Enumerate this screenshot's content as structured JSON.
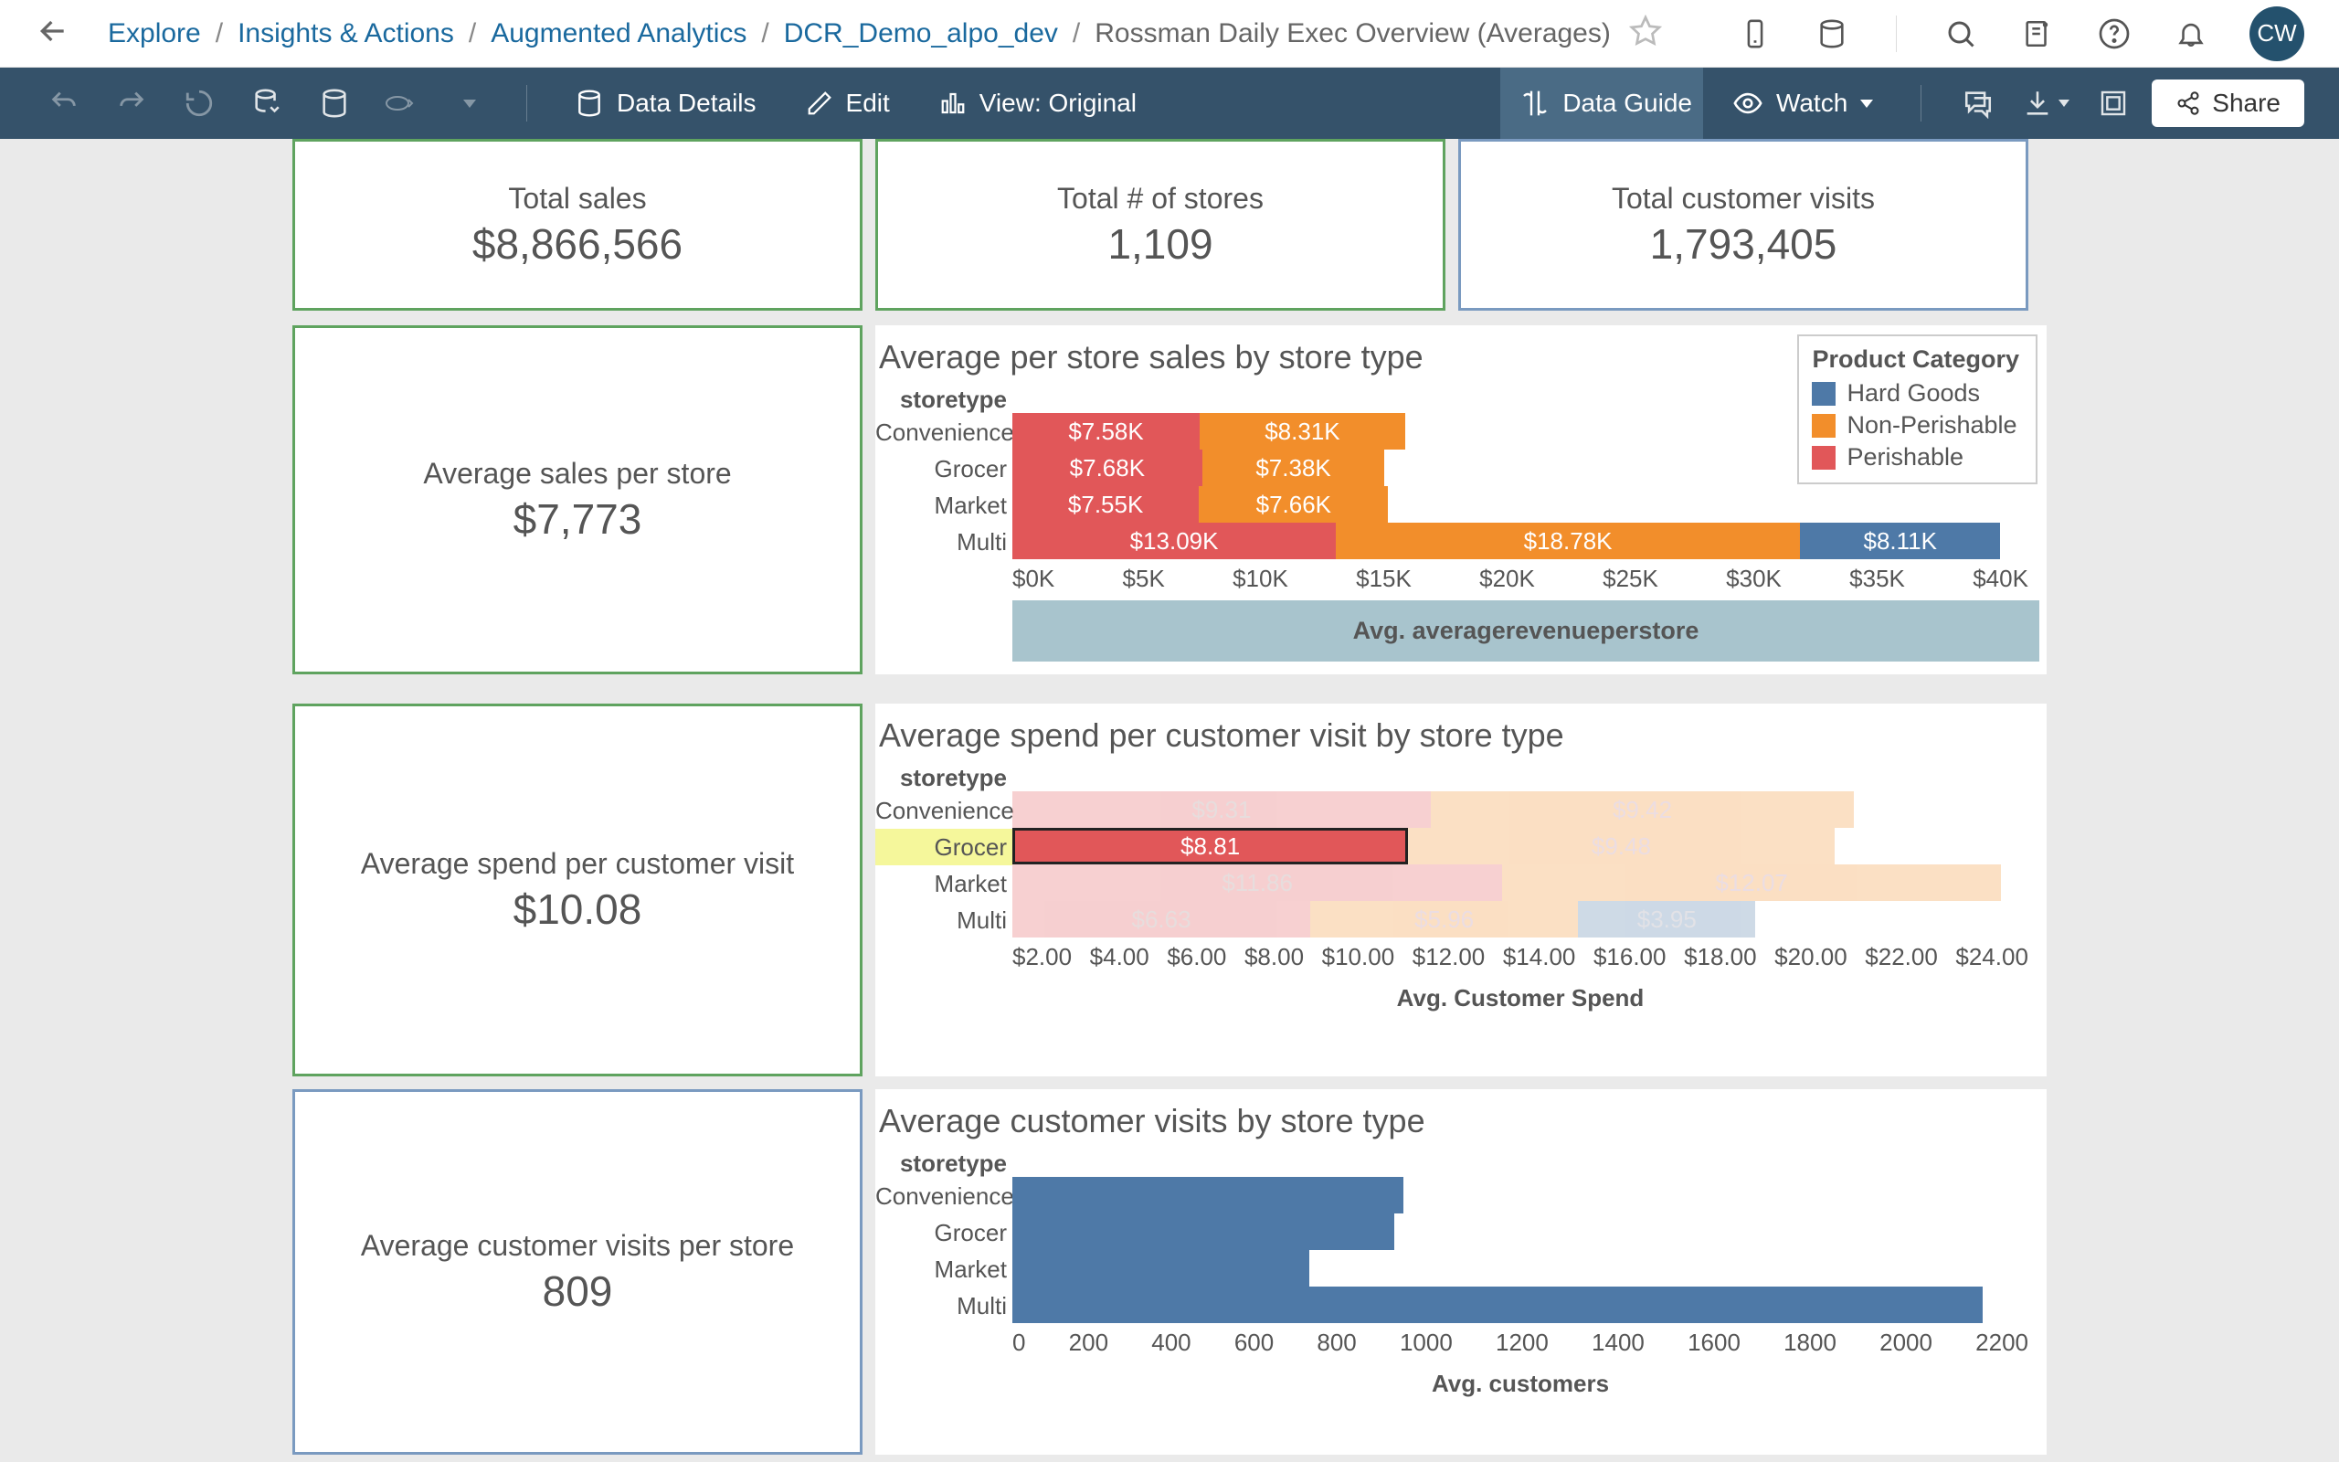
{
  "breadcrumb": {
    "items": [
      "Explore",
      "Insights & Actions",
      "Augmented Analytics",
      "DCR_Demo_alpo_dev"
    ],
    "current": "Rossman Daily Exec Overview (Averages)"
  },
  "avatar": "CW",
  "toolbar": {
    "data_details": "Data Details",
    "edit": "Edit",
    "view": "View: Original",
    "data_guide": "Data Guide",
    "watch": "Watch",
    "share": "Share"
  },
  "kpis": {
    "total_sales": {
      "label": "Total sales",
      "value": "$8,866,566"
    },
    "total_stores": {
      "label": "Total # of stores",
      "value": "1,109"
    },
    "total_visits": {
      "label": "Total customer visits",
      "value": "1,793,405"
    },
    "avg_sales": {
      "label": "Average sales per store",
      "value": "$7,773"
    },
    "avg_spend": {
      "label": "Average spend per customer visit",
      "value": "$10.08"
    },
    "avg_visits": {
      "label": "Average customer visits per store",
      "value": "809"
    }
  },
  "legend": {
    "title": "Product Category",
    "items": [
      {
        "name": "Hard Goods",
        "color": "#4e79a7"
      },
      {
        "name": "Non-Perishable",
        "color": "#f28e2b"
      },
      {
        "name": "Perishable",
        "color": "#e15759"
      }
    ]
  },
  "chart_data": [
    {
      "id": "avg_sales_by_type",
      "title": "Average per store sales by store type",
      "type": "bar",
      "stacked": true,
      "orientation": "h",
      "ylabel": "storetype",
      "xlabel": "Avg. averagerevenueperstore",
      "xlim": [
        0,
        40
      ],
      "xticks": [
        "$0K",
        "$5K",
        "$10K",
        "$15K",
        "$20K",
        "$25K",
        "$30K",
        "$35K",
        "$40K"
      ],
      "categories": [
        "Convenience",
        "Grocer",
        "Market",
        "Multi"
      ],
      "series": [
        {
          "name": "Perishable",
          "color": "#e15759",
          "values": [
            7.58,
            7.68,
            7.55,
            13.09
          ],
          "labels": [
            "$7.58K",
            "$7.68K",
            "$7.55K",
            "$13.09K"
          ]
        },
        {
          "name": "Non-Perishable",
          "color": "#f28e2b",
          "values": [
            8.31,
            7.38,
            7.66,
            18.78
          ],
          "labels": [
            "$8.31K",
            "$7.38K",
            "$7.66K",
            "$18.78K"
          ]
        },
        {
          "name": "Hard Goods",
          "color": "#4e79a7",
          "values": [
            0,
            0,
            0,
            8.11
          ],
          "labels": [
            "",
            "",
            "",
            "$8.11K"
          ]
        }
      ]
    },
    {
      "id": "avg_spend_by_type",
      "title": "Average spend per customer visit by store type",
      "type": "bar",
      "stacked": true,
      "orientation": "h",
      "ylabel": "storetype",
      "xlabel": "Avg. Customer Spend",
      "xlim": [
        2,
        24
      ],
      "xticks": [
        "$2.00",
        "$4.00",
        "$6.00",
        "$8.00",
        "$10.00",
        "$12.00",
        "$14.00",
        "$16.00",
        "$18.00",
        "$20.00",
        "$22.00",
        "$24.00"
      ],
      "categories": [
        "Convenience",
        "Grocer",
        "Market",
        "Multi"
      ],
      "highlight_category": "Grocer",
      "highlight_series": "Perishable",
      "series": [
        {
          "name": "Perishable",
          "color": "#e15759",
          "values": [
            9.31,
            8.81,
            11.86,
            6.63
          ],
          "labels": [
            "$9.31",
            "$8.81",
            "$11.86",
            "$6.63"
          ]
        },
        {
          "name": "Non-Perishable",
          "color": "#f28e2b",
          "values": [
            9.42,
            9.48,
            12.07,
            5.96
          ],
          "labels": [
            "$9.42",
            "$9.48",
            "$12.07",
            "$5.96"
          ]
        },
        {
          "name": "Hard Goods",
          "color": "#4e79a7",
          "values": [
            0,
            0,
            0,
            3.95
          ],
          "labels": [
            "",
            "",
            "",
            "$3.95"
          ]
        }
      ]
    },
    {
      "id": "avg_visits_by_type",
      "title": "Average customer visits by store type",
      "type": "bar",
      "orientation": "h",
      "ylabel": "storetype",
      "xlabel": "Avg. customers",
      "xlim": [
        0,
        2200
      ],
      "xticks": [
        "0",
        "200",
        "400",
        "600",
        "800",
        "1000",
        "1200",
        "1400",
        "1600",
        "1800",
        "2000",
        "2200"
      ],
      "categories": [
        "Convenience",
        "Grocer",
        "Market",
        "Multi"
      ],
      "values": [
        870,
        850,
        660,
        2160
      ],
      "color": "#4e79a7"
    }
  ]
}
